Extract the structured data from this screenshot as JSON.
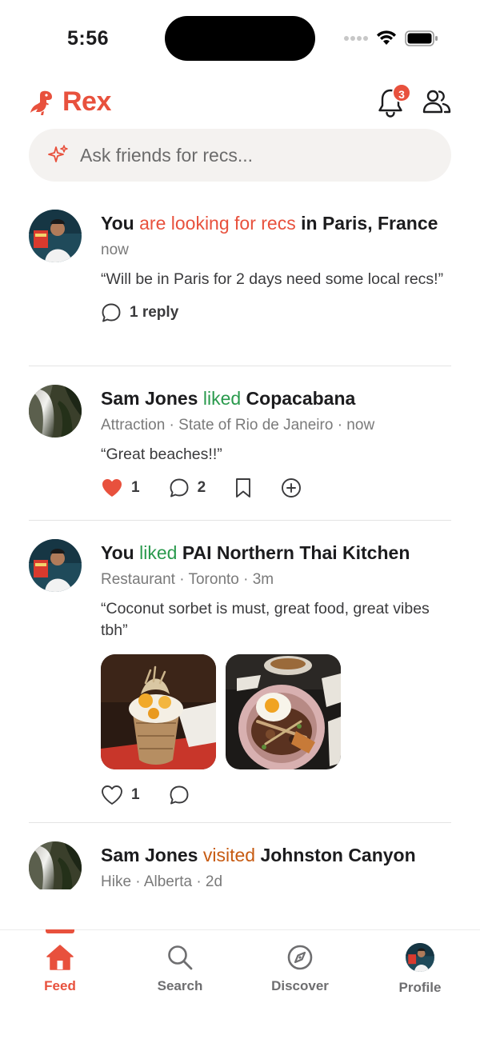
{
  "status_bar": {
    "time": "5:56"
  },
  "header": {
    "app_title": "Rex",
    "notification_count": "3"
  },
  "search": {
    "placeholder": "Ask friends for recs..."
  },
  "posts": [
    {
      "user": "You",
      "verb": "are looking for recs",
      "prep": "in",
      "place": "Paris, France",
      "meta": "now",
      "quote": "“Will be in Paris for 2 days need some local recs!”",
      "reply_label": "1 reply"
    },
    {
      "user": "Sam Jones",
      "verb": "liked",
      "place": "Copacabana",
      "meta": "Attraction · State of Rio de Janeiro · now",
      "quote": "“Great beaches!!”",
      "like_count": "1",
      "comment_count": "2"
    },
    {
      "user": "You",
      "verb": "liked",
      "place": "PAI Northern Thai Kitchen",
      "meta": "Restaurant · Toronto · 3m",
      "quote": "“Coconut sorbet is must, great food, great vibes tbh”",
      "like_count": "1"
    },
    {
      "user": "Sam Jones",
      "verb": "visited",
      "place": "Johnston Canyon",
      "meta": "Hike · Alberta · 2d"
    }
  ],
  "tabs": [
    {
      "label": "Feed",
      "icon": "home-icon",
      "active": true
    },
    {
      "label": "Search",
      "icon": "search-icon",
      "active": false
    },
    {
      "label": "Discover",
      "icon": "compass-icon",
      "active": false
    },
    {
      "label": "Profile",
      "icon": "avatar",
      "active": false
    }
  ],
  "colors": {
    "accent": "#e8513d",
    "liked": "#2a9a4d",
    "visited": "#c75b12"
  }
}
